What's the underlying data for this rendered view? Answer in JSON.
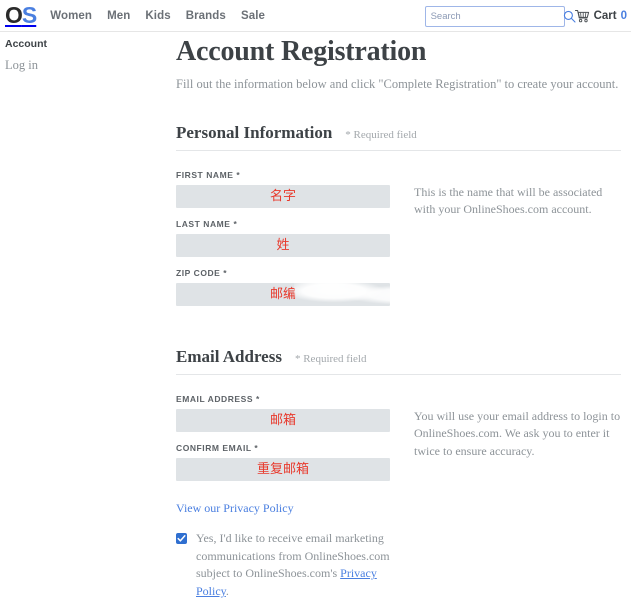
{
  "header": {
    "logo": {
      "first": "O",
      "second": "S",
      "color_dark": "#2b2b2b",
      "color_blue": "#4a7fe0"
    },
    "nav": [
      {
        "label": "Women"
      },
      {
        "label": "Men"
      },
      {
        "label": "Kids"
      },
      {
        "label": "Brands"
      },
      {
        "label": "Sale"
      }
    ],
    "search": {
      "placeholder": "Search",
      "value": "",
      "icon": "search-icon"
    },
    "cart": {
      "icon": "shopping-cart-icon",
      "label": "Cart",
      "count": "0",
      "count_color": "#4a7fe0"
    }
  },
  "sidebar": {
    "heading": "Account",
    "login_link": "Log in"
  },
  "main": {
    "title": "Account Registration",
    "intro": "Fill out the information below and click \"Complete Registration\" to create your account.",
    "sections": [
      {
        "title": "Personal Information",
        "required_note": "* Required field",
        "help": "This is the name that will be associated with your OnlineShoes.com account.",
        "fields": [
          {
            "label": "FIRST NAME *",
            "annotation": "名字"
          },
          {
            "label": "LAST NAME *",
            "annotation": "姓"
          },
          {
            "label": "ZIP CODE *",
            "annotation": "邮编"
          }
        ]
      },
      {
        "title": "Email Address",
        "required_note": "* Required field",
        "help": "You will use your email address to login to OnlineShoes.com. We ask you to enter it twice to ensure accuracy.",
        "fields": [
          {
            "label": "EMAIL ADDRESS *",
            "annotation": "邮箱"
          },
          {
            "label": "CONFIRM EMAIL *",
            "annotation": "重复邮箱"
          }
        ]
      }
    ],
    "privacy_link": "View our Privacy Policy",
    "optin": {
      "checked": true,
      "text_before": "Yes, I'd like to receive email marketing communications from OnlineShoes.com subject to OnlineShoes.com's ",
      "link": "Privacy Policy",
      "text_after": "."
    }
  },
  "colors": {
    "accent_blue": "#4a7fe0",
    "annotation_red": "#e8392c",
    "input_bg": "#dfe3e6",
    "text_dark": "#3d4246",
    "text_muted": "#8d9398"
  }
}
